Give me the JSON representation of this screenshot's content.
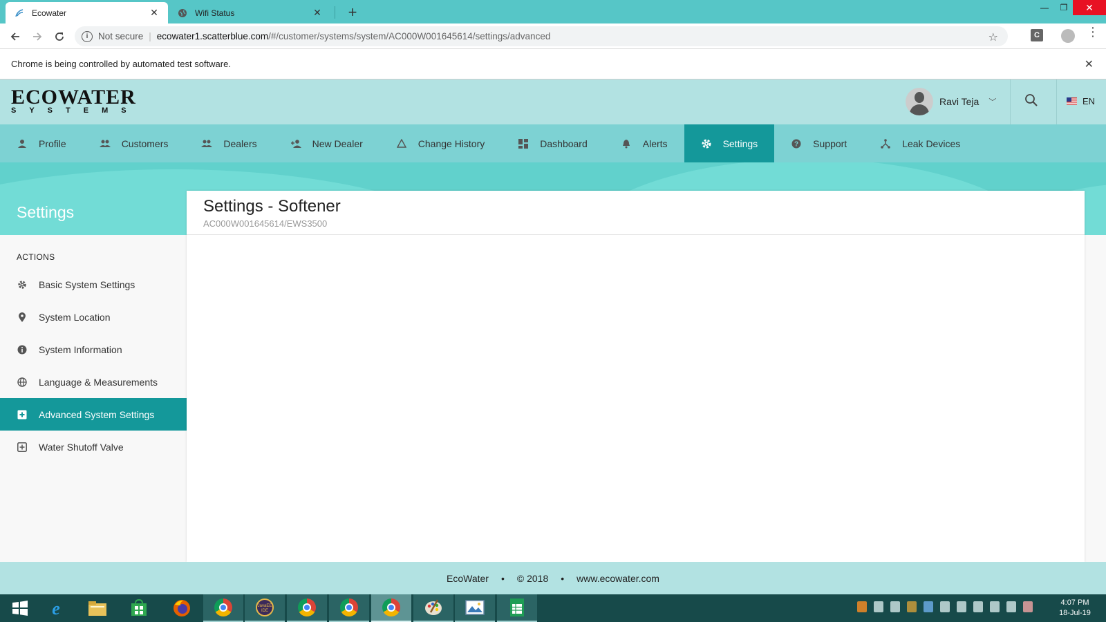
{
  "browser": {
    "tabs": [
      {
        "title": "Ecowater",
        "active": true
      },
      {
        "title": "Wifi Status",
        "active": false
      }
    ],
    "address": {
      "security": "Not secure",
      "host": "ecowater1.scatterblue.com",
      "path": "/#/customer/systems/system/AC000W001645614/settings/advanced"
    },
    "infobar": "Chrome is being controlled by automated test software.",
    "extension_letter": "C"
  },
  "header": {
    "logo_top": "ECOWATER",
    "logo_bottom": "SYSTEMS",
    "user_name": "Ravi Teja",
    "language": "EN"
  },
  "nav": {
    "items": [
      {
        "label": "Profile",
        "icon": "person-icon"
      },
      {
        "label": "Customers",
        "icon": "people-icon"
      },
      {
        "label": "Dealers",
        "icon": "people-icon"
      },
      {
        "label": "New Dealer",
        "icon": "person-add-icon"
      },
      {
        "label": "Change History",
        "icon": "triangle-icon"
      },
      {
        "label": "Dashboard",
        "icon": "dashboard-icon"
      },
      {
        "label": "Alerts",
        "icon": "bell-icon"
      },
      {
        "label": "Settings",
        "icon": "gear-icon",
        "active": true
      },
      {
        "label": "Support",
        "icon": "help-icon"
      },
      {
        "label": "Leak Devices",
        "icon": "device-hub-icon"
      }
    ]
  },
  "sidebar": {
    "title": "Settings",
    "heading": "ACTIONS",
    "items": [
      {
        "label": "Basic System Settings",
        "icon": "gear-icon"
      },
      {
        "label": "System Location",
        "icon": "location-pin-icon"
      },
      {
        "label": "System Information",
        "icon": "info-icon"
      },
      {
        "label": "Language & Measurements",
        "icon": "globe-icon"
      },
      {
        "label": "Advanced System Settings",
        "icon": "plus-box-icon",
        "active": true
      },
      {
        "label": "Water Shutoff Valve",
        "icon": "valve-icon"
      }
    ]
  },
  "panel": {
    "title": "Settings - Softener",
    "subtitle": "AC000W001645614/EWS3500"
  },
  "footer": {
    "brand": "EcoWater",
    "copyright": "© 2018",
    "website": "www.ecowater.com"
  },
  "taskbar": {
    "time": "4:07 PM",
    "date": "18-Jul-19"
  },
  "colors": {
    "accent": "#14989a",
    "nav_bg": "#7dd2d3",
    "header_bg": "#b2e2e2",
    "tabstrip": "#56c6c7"
  }
}
